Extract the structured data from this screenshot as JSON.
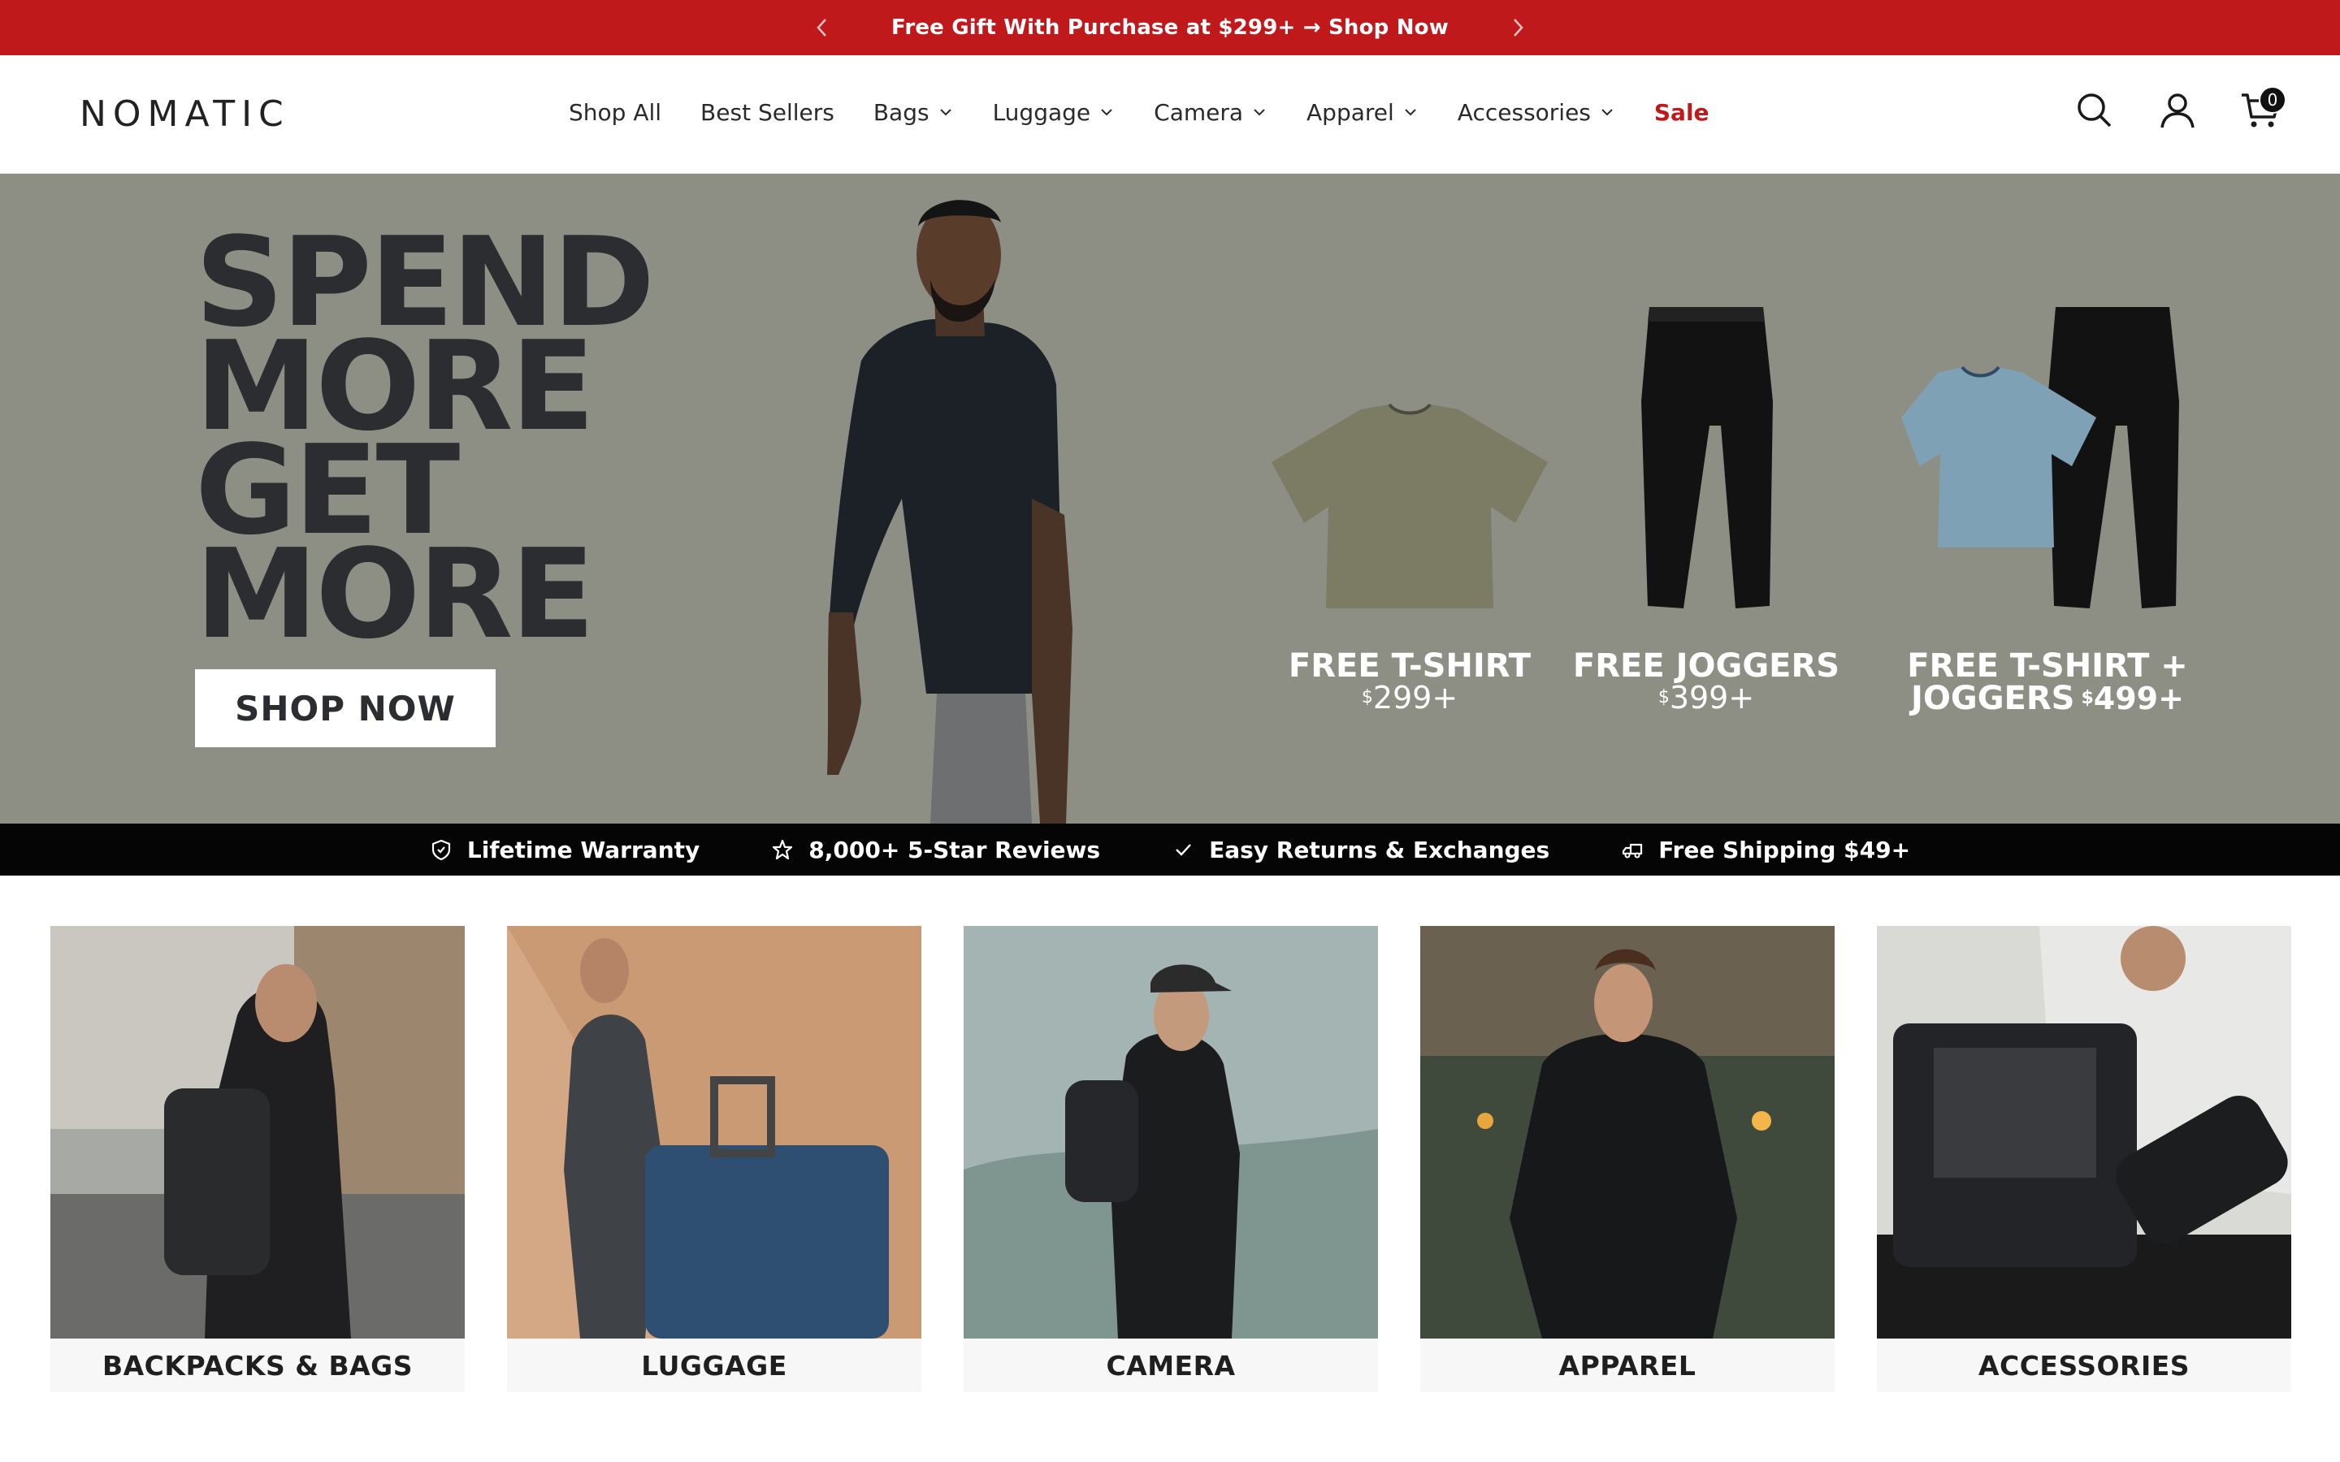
{
  "announcement": {
    "message": "Free Gift With Purchase at $299+ → Shop Now"
  },
  "header": {
    "logo_text": "NOMATIC",
    "nav": [
      {
        "label": "Shop All",
        "dropdown": false
      },
      {
        "label": "Best Sellers",
        "dropdown": false
      },
      {
        "label": "Bags",
        "dropdown": true
      },
      {
        "label": "Luggage",
        "dropdown": true
      },
      {
        "label": "Camera",
        "dropdown": true
      },
      {
        "label": "Apparel",
        "dropdown": true
      },
      {
        "label": "Accessories",
        "dropdown": true
      },
      {
        "label": "Sale",
        "dropdown": false
      }
    ],
    "cart_count": "0"
  },
  "hero": {
    "headline": [
      "SPEND",
      "MORE",
      "GET",
      "MORE"
    ],
    "cta": "SHOP NOW",
    "offers": [
      {
        "label_lines": [
          "FREE T-SHIRT"
        ],
        "price_symbol": "$",
        "price": "299+"
      },
      {
        "label_lines": [
          "FREE JOGGERS"
        ],
        "price_symbol": "$",
        "price": "399+"
      },
      {
        "label_lines": [
          "FREE T-SHIRT +",
          "JOGGERS"
        ],
        "price_symbol": "$",
        "price": "499+"
      }
    ]
  },
  "trust_bar": [
    {
      "icon": "shield-icon",
      "label": "Lifetime Warranty"
    },
    {
      "icon": "star-icon",
      "label": "8,000+ 5-Star Reviews"
    },
    {
      "icon": "checkmark-icon",
      "label": "Easy Returns & Exchanges"
    },
    {
      "icon": "delivery-truck-icon",
      "label": "Free Shipping $49+"
    }
  ],
  "categories": [
    {
      "label": "BACKPACKS & BAGS"
    },
    {
      "label": "LUGGAGE"
    },
    {
      "label": "CAMERA"
    },
    {
      "label": "APPAREL"
    },
    {
      "label": "ACCESSORIES"
    }
  ],
  "colors": {
    "announcement_bg": "#c0191c",
    "sale_text": "#c0191c",
    "hero_bg": "#8d8f84",
    "headline_text": "#2b2d31",
    "trust_bar_bg": "#050505"
  }
}
